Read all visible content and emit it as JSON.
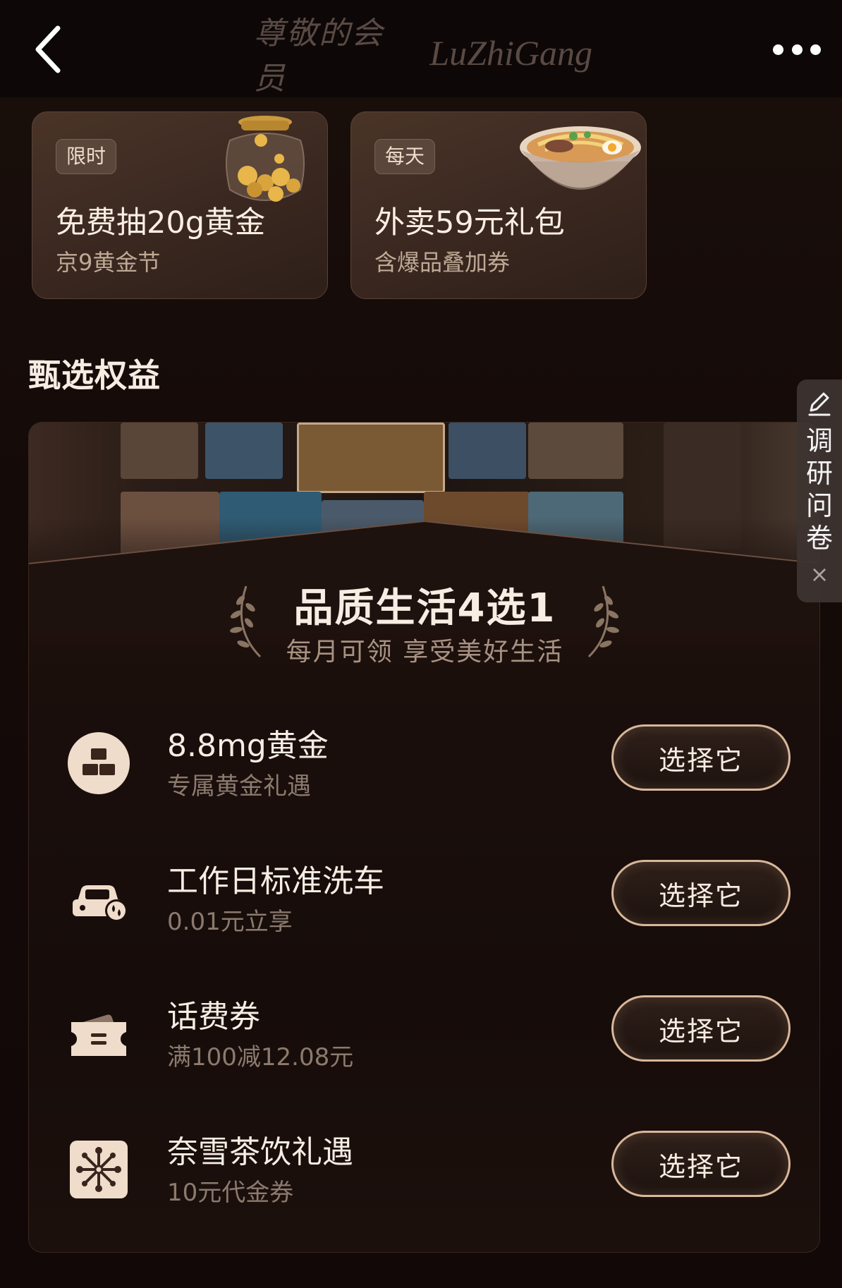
{
  "header": {
    "title_cn": "尊敬的会员",
    "title_en": "LuZhiGang"
  },
  "promos": [
    {
      "tag": "限时",
      "title": "免费抽20g黄金",
      "subtitle": "京9黄金节",
      "art": "gold-jar-icon"
    },
    {
      "tag": "每天",
      "title": "外卖59元礼包",
      "subtitle": "含爆品叠加券",
      "art": "ramen-bowl-icon"
    }
  ],
  "section": {
    "title": "甄选权益"
  },
  "survey": {
    "label": "调研问卷",
    "close": "×"
  },
  "plan": {
    "title": "品质生活4选1",
    "subtitle": "每月可领 享受美好生活"
  },
  "benefits": [
    {
      "name": "8.8mg黄金",
      "desc": "专属黄金礼遇",
      "button": "选择它",
      "icon": "gold-bar-icon"
    },
    {
      "name": "工作日标准洗车",
      "desc": "0.01元立享",
      "button": "选择它",
      "icon": "car-wash-icon"
    },
    {
      "name": "话费券",
      "desc": "满100减12.08元",
      "button": "选择它",
      "icon": "phone-ticket-icon"
    },
    {
      "name": "奈雪茶饮礼遇",
      "desc": "10元代金券",
      "button": "选择它",
      "icon": "tea-flower-icon"
    }
  ],
  "colors": {
    "background": "#120a08",
    "accent_gold": "#d9b79a",
    "text_primary": "#f7ede3",
    "text_secondary": "#8c7a6e"
  }
}
